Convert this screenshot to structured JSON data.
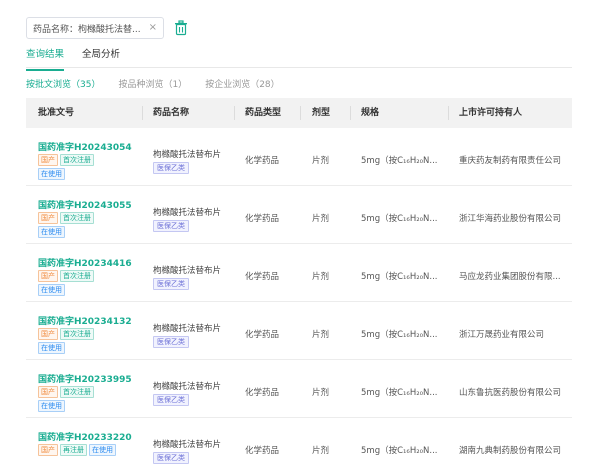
{
  "filter": {
    "chip_text": "药品名称：枸橼酸托法替...",
    "close_glyph": "×"
  },
  "main_tabs": [
    {
      "label": "查询结果",
      "active": true
    },
    {
      "label": "全局分析",
      "active": false
    }
  ],
  "sub_tabs": [
    {
      "label": "按批文浏览（35）",
      "active": true
    },
    {
      "label": "按品种浏览（1）",
      "active": false
    },
    {
      "label": "按企业浏览（28）",
      "active": false
    }
  ],
  "table": {
    "headers": [
      "批准文号",
      "药品名称",
      "药品类型",
      "剂型",
      "规格",
      "上市许可持有人"
    ],
    "rows": [
      {
        "approval_no": "国药准字H20243054",
        "tags": [
          "国产",
          "首次注册",
          "在使用"
        ],
        "drug_name": "枸橼酸托法替布片",
        "insurance": "医保乙类",
        "drug_type": "化学药品",
        "form": "片剂",
        "spec": "5mg（按C₁₆H₂₀N...",
        "holder": "重庆药友制药有限责任公司"
      },
      {
        "approval_no": "国药准字H20243055",
        "tags": [
          "国产",
          "首次注册",
          "在使用"
        ],
        "drug_name": "枸橼酸托法替布片",
        "insurance": "医保乙类",
        "drug_type": "化学药品",
        "form": "片剂",
        "spec": "5mg（按C₁₆H₂₀N...",
        "holder": "浙江华海药业股份有限公司"
      },
      {
        "approval_no": "国药准字H20234416",
        "tags": [
          "国产",
          "首次注册",
          "在使用"
        ],
        "drug_name": "枸橼酸托法替布片",
        "insurance": "医保乙类",
        "drug_type": "化学药品",
        "form": "片剂",
        "spec": "5mg（按C₁₆H₂₀N...",
        "holder": "马应龙药业集团股份有限..."
      },
      {
        "approval_no": "国药准字H20234132",
        "tags": [
          "国产",
          "首次注册",
          "在使用"
        ],
        "drug_name": "枸橼酸托法替布片",
        "insurance": "医保乙类",
        "drug_type": "化学药品",
        "form": "片剂",
        "spec": "5mg（按C₁₆H₂₀N...",
        "holder": "浙江万晟药业有限公司"
      },
      {
        "approval_no": "国药准字H20233995",
        "tags": [
          "国产",
          "首次注册",
          "在使用"
        ],
        "drug_name": "枸橼酸托法替布片",
        "insurance": "医保乙类",
        "drug_type": "化学药品",
        "form": "片剂",
        "spec": "5mg（按C₁₆H₂₀N...",
        "holder": "山东鲁抗医药股份有限公司"
      },
      {
        "approval_no": "国药准字H20233220",
        "tags": [
          "国产",
          "再注册",
          "在使用"
        ],
        "drug_name": "枸橼酸托法替布片",
        "insurance": "医保乙类",
        "drug_type": "化学药品",
        "form": "片剂",
        "spec": "5mg（按C₁₆H₂₀N...",
        "holder": "湖南九典制药股份有限公司"
      }
    ]
  },
  "colors": {
    "accent": "#1aad91",
    "tag_domestic": "#f08a3c",
    "tag_register": "#1aad91",
    "tag_in_use": "#2d8cf0",
    "tag_insurance": "#6b6fd6"
  },
  "icons": {
    "delete_filter": "trash-icon",
    "remove_chip": "close-icon"
  }
}
